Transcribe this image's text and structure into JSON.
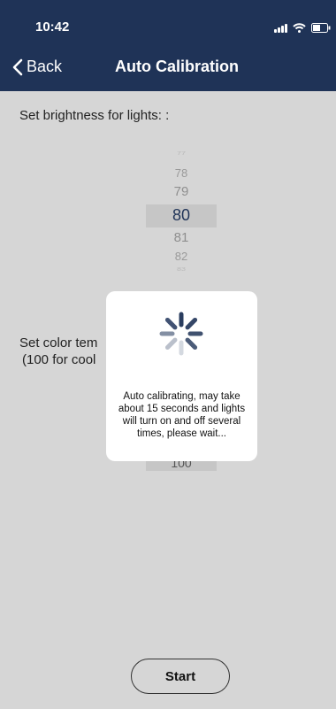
{
  "status": {
    "time": "10:42"
  },
  "nav": {
    "back_label": "Back",
    "title": "Auto Calibration"
  },
  "brightness": {
    "label": "Set brightness for lights: :",
    "options": [
      "77",
      "78",
      "79",
      "80",
      "81",
      "82",
      "83"
    ],
    "selected": "80"
  },
  "color_temp": {
    "label_line1": "Set color tem",
    "label_line2": "(100 for cool",
    "selected_partial": "100"
  },
  "dialog": {
    "message": "Auto calibrating, may take about 15 seconds and lights will turn on and off several times, please wait..."
  },
  "actions": {
    "start_label": "Start"
  },
  "colors": {
    "header_bg": "#1f3357",
    "screen_bg": "#d6d6d6",
    "spinner": "#1f3357"
  }
}
